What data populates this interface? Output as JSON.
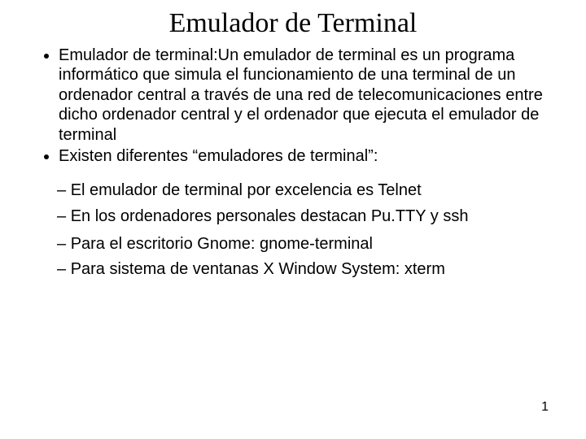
{
  "title": "Emulador de Terminal",
  "bullets": {
    "b1": "Emulador de terminal:Un emulador de terminal es un programa informático que simula el funcionamiento de una terminal de un ordenador central a través de una red de telecomunicaciones entre dicho ordenador central y el ordenador que ejecuta el emulador de terminal",
    "b2": "Existen diferentes  “emuladores de terminal”:"
  },
  "subbullets": {
    "s1": "El emulador de terminal por excelencia es Telnet",
    "s2": "En los ordenadores personales destacan Pu.TTY y ssh",
    "s3": "Para el escritorio Gnome: gnome-terminal",
    "s4": "Para sistema de ventanas X Window System: xterm"
  },
  "page_number": "1"
}
